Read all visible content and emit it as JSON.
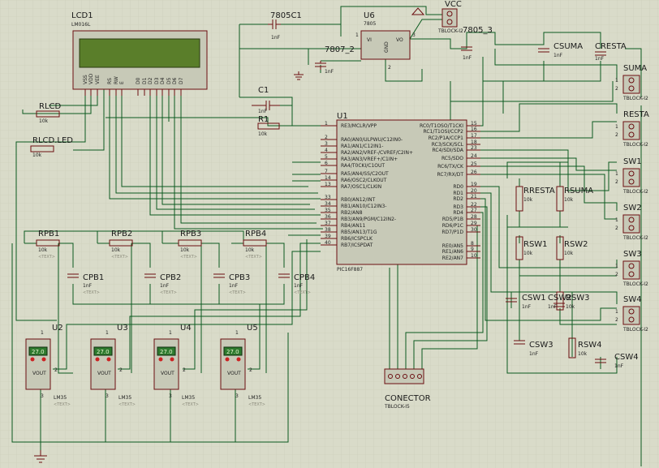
{
  "colors": {
    "background": "#d9dbc9",
    "wire": "#0a5a1e",
    "component": "#6b0d10",
    "lcd_screen": "#5a7e2a",
    "sensor_display": "#2e7a2e"
  },
  "placeholder_text": "<TEXT>",
  "lcd": {
    "ref": "LCD1",
    "part": "LM016L",
    "pins": [
      "VSS",
      "VDD",
      "VEE",
      "RS",
      "RW",
      "E",
      "D0",
      "D1",
      "D2",
      "D3",
      "D4",
      "D5",
      "D6",
      "D7"
    ]
  },
  "capacitors": {
    "c7805c1": {
      "ref": "7805C1",
      "value": "1nF"
    },
    "c7807_2": {
      "ref": "7807_2",
      "value": "1nF"
    },
    "c7805_3": {
      "ref": "7805_3",
      "value": "1nF"
    },
    "c1": {
      "ref": "C1",
      "value": "1nF"
    },
    "csuma": {
      "ref": "CSUMA",
      "value": "1nF"
    },
    "cresta": {
      "ref": "CRESTA",
      "value": "1nF"
    },
    "cpb1": {
      "ref": "CPB1",
      "value": "1nF"
    },
    "cpb2": {
      "ref": "CPB2",
      "value": "1nF"
    },
    "cpb3": {
      "ref": "CPB3",
      "value": "1nF"
    },
    "cpb4": {
      "ref": "CPB4",
      "value": "1nF"
    },
    "csw1": {
      "ref": "CSW1",
      "value": "1nF"
    },
    "csw2": {
      "ref": "CSW2",
      "value": "1nF"
    },
    "csw3": {
      "ref": "CSW3",
      "value": "1nF"
    },
    "csw4": {
      "ref": "CSW4",
      "value": "1nF"
    }
  },
  "resistors": {
    "rlcd": {
      "ref": "RLCD",
      "value": "10k"
    },
    "rlcdled": {
      "ref": "RLCD.LED",
      "value": "10k"
    },
    "r1": {
      "ref": "R1",
      "value": "10k"
    },
    "rpb1": {
      "ref": "RPB1",
      "value": "10k"
    },
    "rpb2": {
      "ref": "RPB2",
      "value": "10k"
    },
    "rpb3": {
      "ref": "RPB3",
      "value": "10k"
    },
    "rpb4": {
      "ref": "RPB4",
      "value": "10k"
    },
    "rresta": {
      "ref": "RRESTA",
      "value": "10k"
    },
    "rsuma": {
      "ref": "RSUMA",
      "value": "10k"
    },
    "rsw1": {
      "ref": "RSW1",
      "value": "10k"
    },
    "rsw2": {
      "ref": "RSW2",
      "value": "10k"
    },
    "rsw3": {
      "ref": "RSW3",
      "value": "10k"
    },
    "rsw4": {
      "ref": "RSW4",
      "value": "10k"
    }
  },
  "regulator": {
    "ref": "U6",
    "part": "7805",
    "vi": "VI",
    "vo": "VO",
    "gnd": "GND",
    "pin1": "1",
    "pin2": "2",
    "pin3": "3"
  },
  "vcc": {
    "ref": "VCC",
    "part": "TBLOCK-I2"
  },
  "mcu": {
    "ref": "U1",
    "part": "PIC16F887",
    "left": [
      {
        "n": "1",
        "name": "RE3/MCLR/VPP"
      },
      {
        "n": "2",
        "name": "RA0/AN0/ULPWU/C12IN0-"
      },
      {
        "n": "3",
        "name": "RA1/AN1/C12IN1-"
      },
      {
        "n": "4",
        "name": "RA2/AN2/VREF-/CVREF/C2IN+"
      },
      {
        "n": "5",
        "name": "RA3/AN3/VREF+/C1IN+"
      },
      {
        "n": "6",
        "name": "RA4/T0CKI/C1OUT"
      },
      {
        "n": "7",
        "name": "RA5/AN4/SS/C2OUT"
      },
      {
        "n": "14",
        "name": "RA6/OSC2/CLKOUT"
      },
      {
        "n": "13",
        "name": "RA7/OSC1/CLKIN"
      },
      {
        "n": "33",
        "name": "RB0/AN12/INT"
      },
      {
        "n": "34",
        "name": "RB1/AN10/C12IN3-"
      },
      {
        "n": "35",
        "name": "RB2/AN8"
      },
      {
        "n": "36",
        "name": "RB3/AN9/PGM/C12IN2-"
      },
      {
        "n": "37",
        "name": "RB4/AN11"
      },
      {
        "n": "38",
        "name": "RB5/AN13/T1G"
      },
      {
        "n": "39",
        "name": "RB6/ICSPCLK"
      },
      {
        "n": "40",
        "name": "RB7/ICSPDAT"
      }
    ],
    "right": [
      {
        "n": "15",
        "name": "RC0/T1OSO/T1CKI"
      },
      {
        "n": "16",
        "name": "RC1/T1OSI/CCP2"
      },
      {
        "n": "17",
        "name": "RC2/P1A/CCP1"
      },
      {
        "n": "18",
        "name": "RC3/SCK/SCL"
      },
      {
        "n": "23",
        "name": "RC4/SDI/SDA"
      },
      {
        "n": "24",
        "name": "RC5/SDO"
      },
      {
        "n": "25",
        "name": "RC6/TX/CK"
      },
      {
        "n": "26",
        "name": "RC7/RX/DT"
      },
      {
        "n": "19",
        "name": "RD0"
      },
      {
        "n": "20",
        "name": "RD1"
      },
      {
        "n": "21",
        "name": "RD2"
      },
      {
        "n": "22",
        "name": "RD3"
      },
      {
        "n": "27",
        "name": "RD4"
      },
      {
        "n": "28",
        "name": "RD5/P1B"
      },
      {
        "n": "29",
        "name": "RD6/P1C"
      },
      {
        "n": "30",
        "name": "RD7/P1D"
      },
      {
        "n": "8",
        "name": "RE0/AN5"
      },
      {
        "n": "9",
        "name": "RE1/AN6"
      },
      {
        "n": "10",
        "name": "RE2/AN7"
      }
    ]
  },
  "connectors": [
    {
      "ref": "SUMA",
      "part": "TBLOCK-I2"
    },
    {
      "ref": "RESTA",
      "part": "TBLOCK-I2"
    },
    {
      "ref": "SW1",
      "part": "TBLOCK-I2"
    },
    {
      "ref": "SW2",
      "part": "TBLOCK-I2"
    },
    {
      "ref": "SW3",
      "part": "TBLOCK-I2"
    },
    {
      "ref": "SW4",
      "part": "TBLOCK-I2"
    }
  ],
  "conector": {
    "ref": "CONECTOR",
    "part": "TBLOCK-I5"
  },
  "sensors": [
    {
      "ref": "U2",
      "part": "LM35",
      "reading": "27.0",
      "vout": "VOUT"
    },
    {
      "ref": "U3",
      "part": "LM35",
      "reading": "27.0",
      "vout": "VOUT"
    },
    {
      "ref": "U4",
      "part": "LM35",
      "reading": "27.0",
      "vout": "VOUT"
    },
    {
      "ref": "U5",
      "part": "LM35",
      "reading": "27.0",
      "vout": "VOUT"
    }
  ]
}
